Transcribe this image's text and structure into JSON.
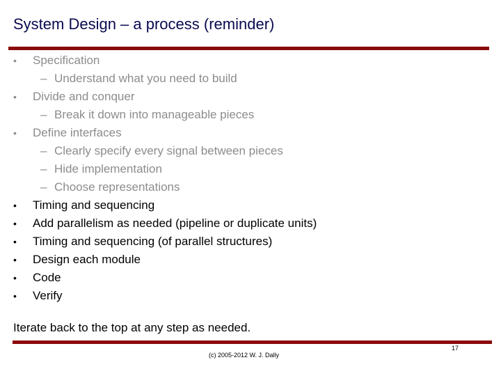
{
  "slide": {
    "title": "System Design – a process (reminder)",
    "items": [
      {
        "level": 1,
        "marker": "•",
        "text": "Specification",
        "state": "dimmed"
      },
      {
        "level": 2,
        "marker": "–",
        "text": "Understand what you need to build",
        "state": "dimmed"
      },
      {
        "level": 1,
        "marker": "•",
        "text": "Divide and conquer",
        "state": "dimmed"
      },
      {
        "level": 2,
        "marker": "–",
        "text": "Break it down into manageable pieces",
        "state": "dimmed"
      },
      {
        "level": 1,
        "marker": "•",
        "text": "Define interfaces",
        "state": "dimmed"
      },
      {
        "level": 2,
        "marker": "–",
        "text": "Clearly specify every signal between pieces",
        "state": "dimmed"
      },
      {
        "level": 2,
        "marker": "–",
        "text": "Hide implementation",
        "state": "dimmed"
      },
      {
        "level": 2,
        "marker": "–",
        "text": "Choose representations",
        "state": "dimmed"
      },
      {
        "level": 1,
        "marker": "•",
        "text": "Timing and sequencing",
        "state": "active"
      },
      {
        "level": 1,
        "marker": "•",
        "text": "Add parallelism as needed (pipeline or duplicate units)",
        "state": "active"
      },
      {
        "level": 1,
        "marker": "•",
        "text": "Timing and sequencing (of parallel structures)",
        "state": "active"
      },
      {
        "level": 1,
        "marker": "•",
        "text": "Design each module",
        "state": "active"
      },
      {
        "level": 1,
        "marker": "•",
        "text": "Code",
        "state": "active"
      },
      {
        "level": 1,
        "marker": "•",
        "text": "Verify",
        "state": "active"
      }
    ],
    "footnote": "Iterate back to the top at any step as needed.",
    "copyright": "(c) 2005-2012 W. J. Dally",
    "page_number": "17"
  },
  "colors": {
    "title": "#0a0a50",
    "rule": "#8b0a0a",
    "dimmed_text": "#8c8c8c",
    "active_text": "#000000"
  }
}
